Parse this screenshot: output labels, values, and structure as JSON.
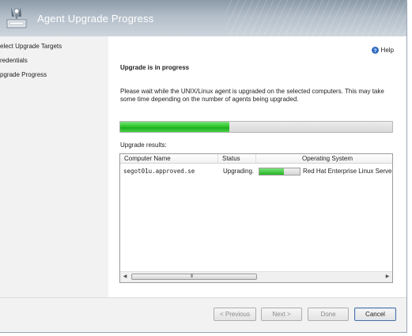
{
  "window": {
    "title": "Agent Upgrade Progress"
  },
  "nav": {
    "items": [
      {
        "label": "elect Upgrade Targets"
      },
      {
        "label": "redentials"
      },
      {
        "label": "pgrade Progress"
      }
    ]
  },
  "help": {
    "label": "Help",
    "icon": "help-icon"
  },
  "main": {
    "heading": "Upgrade is in progress",
    "description": "Please wait while the UNIX/Linux agent is upgraded on the selected computers. This may take some time depending on the number of agents being upgraded.",
    "progress_percent": 40,
    "results_label": "Upgrade results:"
  },
  "table": {
    "columns": [
      "Computer Name",
      "Status",
      "Operating System"
    ],
    "rows": [
      {
        "computer": "segot01u.approved.se",
        "status": "Upgrading.",
        "progress_percent": 60,
        "os": "Red Hat Enterprise Linux Server r"
      }
    ],
    "scroll_grip": "III"
  },
  "footer": {
    "previous": "< Previous",
    "next": "Next >",
    "done": "Done",
    "cancel": "Cancel"
  },
  "colors": {
    "progress_green": "#33cc33",
    "header_blue": "#8c9aa8",
    "accent_border": "#4a6f9e"
  }
}
